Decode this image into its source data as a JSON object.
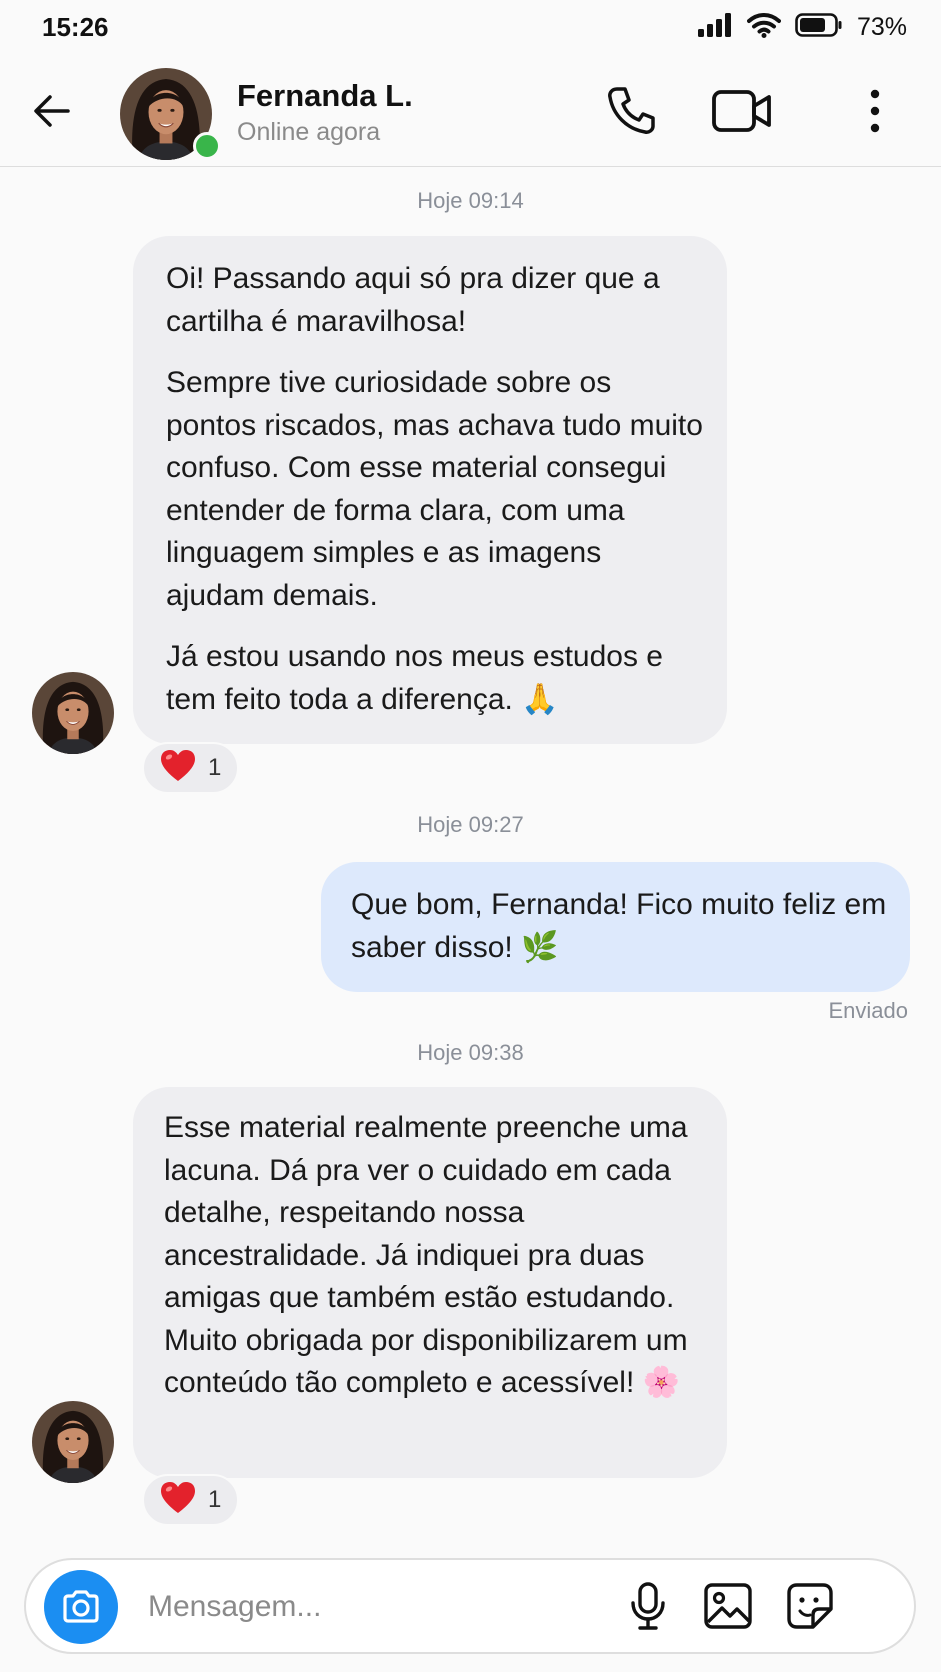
{
  "status_bar": {
    "time": "15:26",
    "battery": "73%"
  },
  "header": {
    "name": "Fernanda L.",
    "status": "Online agora"
  },
  "icons": {
    "back": "arrow-left-icon",
    "call": "phone-icon",
    "video": "video-camera-icon",
    "more": "more-vertical-icon",
    "camera": "camera-icon",
    "mic": "microphone-icon",
    "gallery": "image-icon",
    "sticker": "sticker-icon",
    "heart": "heart-emoji"
  },
  "colors": {
    "incoming_bubble": "#eeeef1",
    "outgoing_bubble": "#dde9fc",
    "online_dot": "#39b54a",
    "camera_button": "#1b8ef2"
  },
  "conversation": [
    {
      "timestamp": "Hoje 09:14",
      "direction": "incoming",
      "paragraphs": [
        "Oi! Passando aqui só pra dizer que a cartilha é maravilhosa!",
        "Sempre tive curiosidade sobre os pontos riscados, mas achava tudo muito confuso. Com esse material consegui entender de forma clara, com uma linguagem simples e as imagens ajudam demais.",
        "Já estou usando nos meus estudos e tem feito toda a diferença. 🙏"
      ],
      "reaction": {
        "emoji": "❤️",
        "count": "1"
      }
    },
    {
      "timestamp": "Hoje 09:27",
      "direction": "outgoing",
      "paragraphs": [
        "Que bom, Fernanda! Fico muito feliz em saber disso! 🌿"
      ],
      "status": "Enviado"
    },
    {
      "timestamp": "Hoje 09:38",
      "direction": "incoming",
      "paragraphs": [
        "Esse material realmente preenche uma lacuna. Dá pra ver o cuidado em cada detalhe, respeitando nossa ancestralidade. Já indiquei pra duas amigas que também estão estudando. Muito obrigada por disponibilizarem um conteúdo tão completo e acessível! 🌸"
      ],
      "reaction": {
        "emoji": "❤️",
        "count": "1"
      }
    }
  ],
  "composer": {
    "placeholder": "Mensagem..."
  }
}
